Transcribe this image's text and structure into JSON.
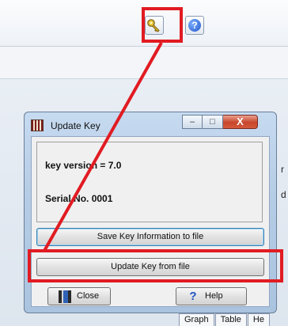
{
  "app": {
    "toolbar": {
      "key_icon": "key-icon",
      "help_icon": "help-icon",
      "help_glyph": "?"
    },
    "side_chars": [
      "r",
      "d"
    ],
    "bottom_tabs": [
      "Graph",
      "Table",
      "He"
    ]
  },
  "dialog": {
    "title": "Update Key",
    "title_icon": "app-icon",
    "caption": {
      "minimize": "–",
      "maximize": "□",
      "close": "X"
    },
    "key_version": "key version = 7.0",
    "serial": "Serial No. 0001",
    "save_button": "Save Key Information to file",
    "update_button": "Update Key from file",
    "close_button": "Close",
    "help_button": "Help",
    "help_glyph": "?"
  },
  "annotation": {
    "color": "#e11b22"
  }
}
